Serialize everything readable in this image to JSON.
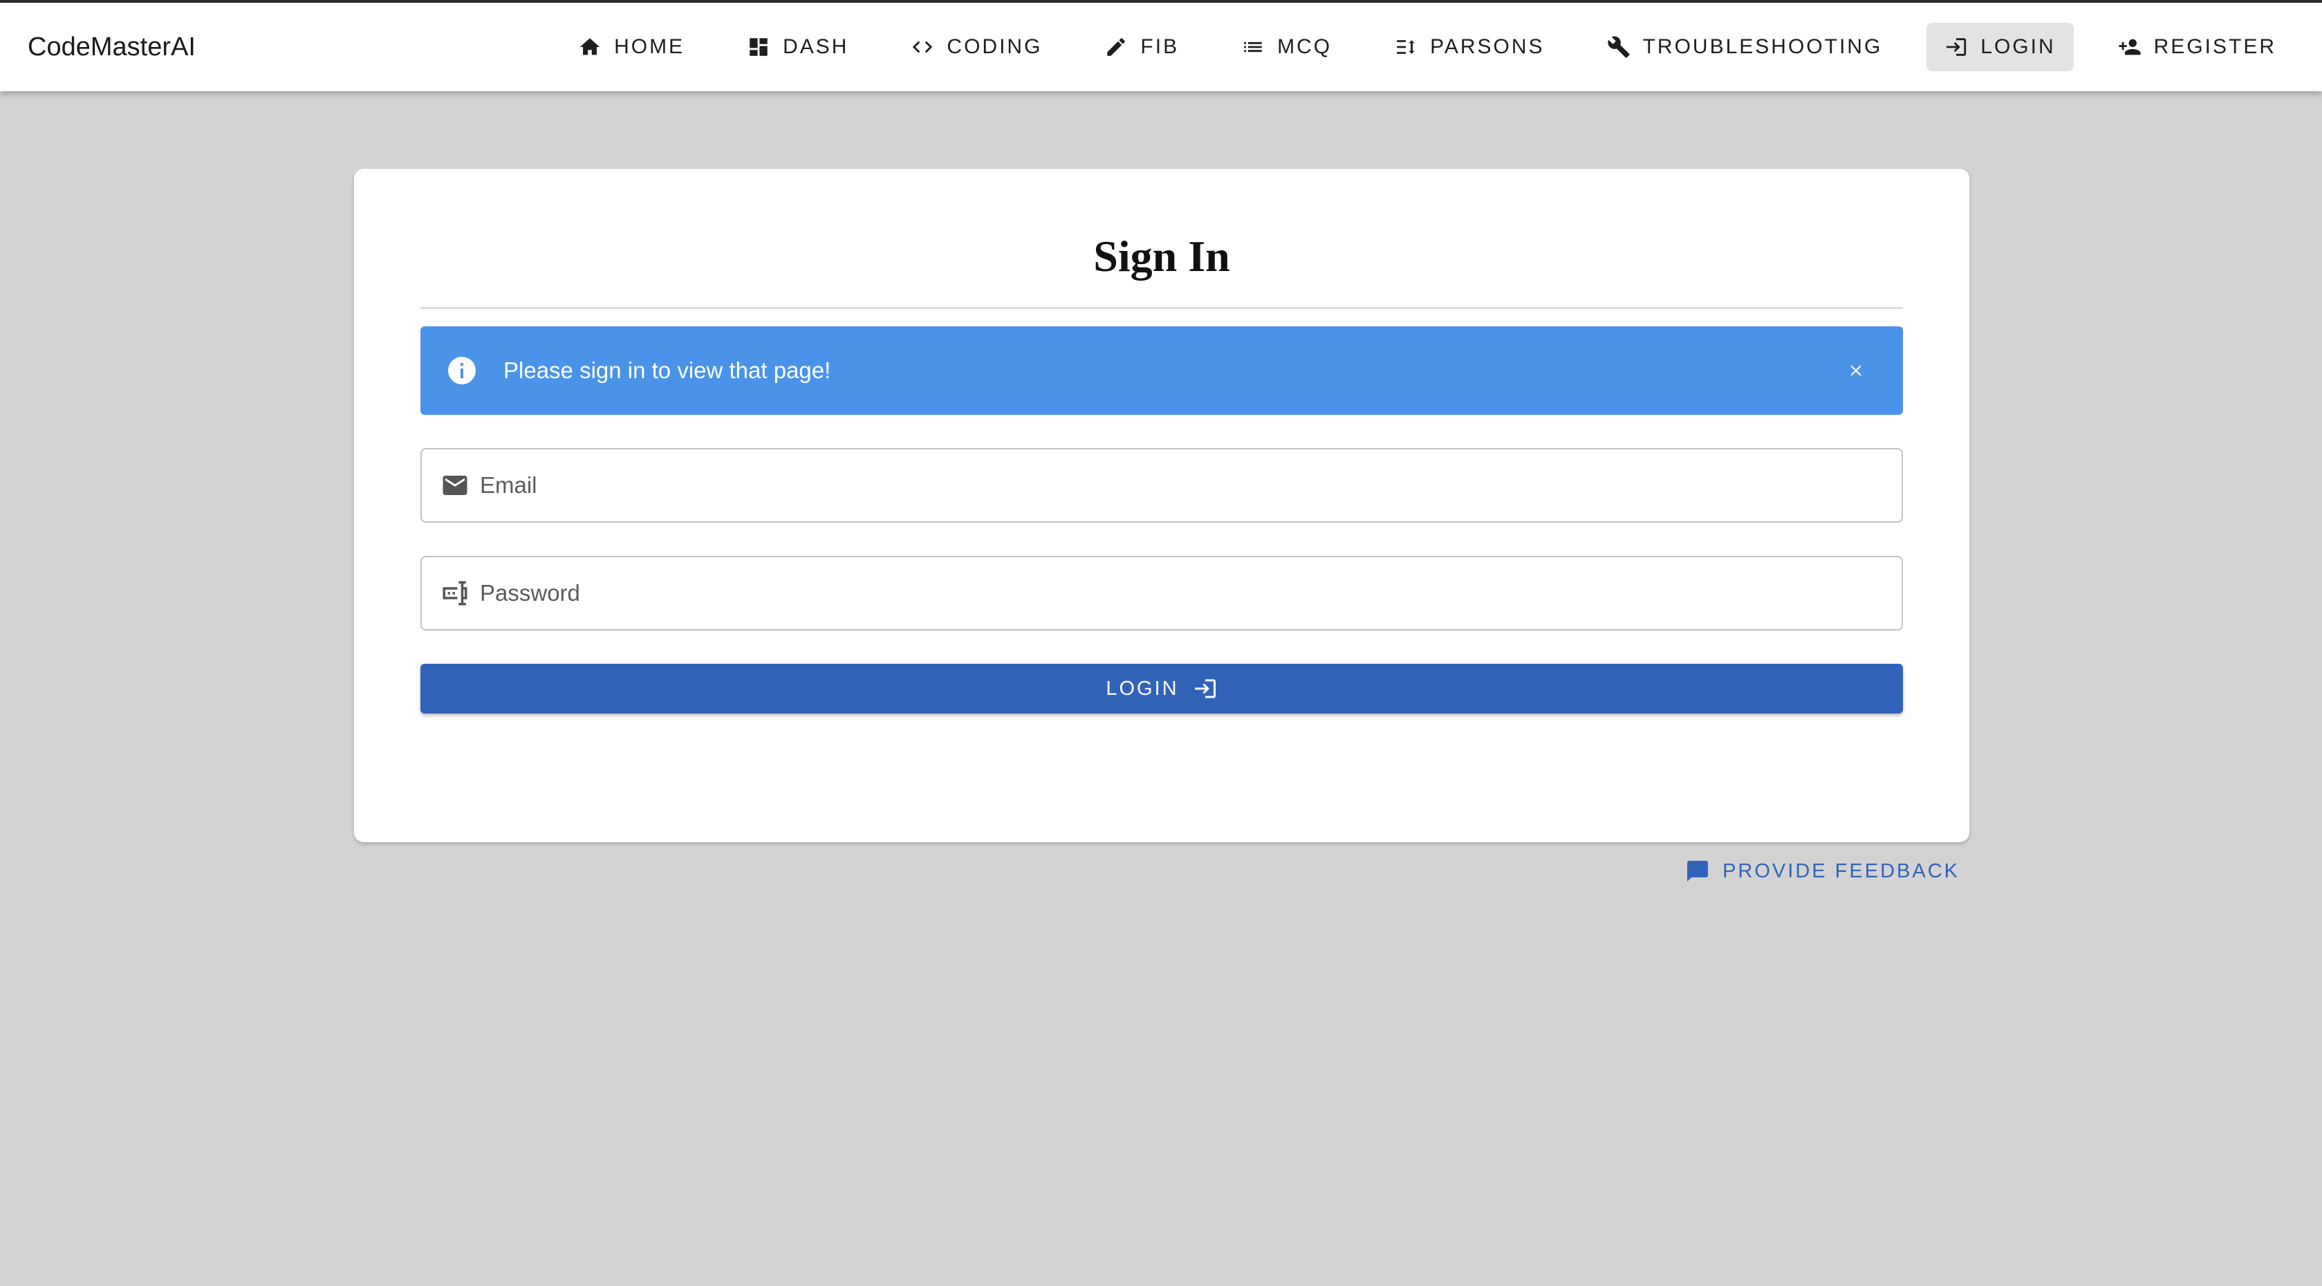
{
  "app": {
    "brand": "CodeMasterAI"
  },
  "nav": {
    "items": [
      {
        "label": "HOME",
        "icon": "home-icon"
      },
      {
        "label": "DASH",
        "icon": "dashboard-icon"
      },
      {
        "label": "CODING",
        "icon": "code-icon"
      },
      {
        "label": "FIB",
        "icon": "pencil-icon"
      },
      {
        "label": "MCQ",
        "icon": "list-icon"
      },
      {
        "label": "PARSONS",
        "icon": "reorder-icon"
      },
      {
        "label": "TROUBLESHOOTING",
        "icon": "wrench-icon"
      },
      {
        "label": "LOGIN",
        "icon": "login-icon",
        "active": true
      },
      {
        "label": "REGISTER",
        "icon": "person-add-icon"
      }
    ]
  },
  "signin": {
    "title": "Sign In",
    "alert": {
      "message": "Please sign in to view that page!",
      "icon": "info-icon"
    },
    "email": {
      "placeholder": "Email",
      "value": "",
      "icon": "mail-icon"
    },
    "password": {
      "placeholder": "Password",
      "value": "",
      "icon": "password-icon"
    },
    "submit_label": "LOGIN"
  },
  "feedback": {
    "label": "PROVIDE FEEDBACK",
    "icon": "chat-icon"
  },
  "colors": {
    "primary": "#3263b9",
    "alert": "#4a93e9",
    "background": "#d3d3d3"
  }
}
